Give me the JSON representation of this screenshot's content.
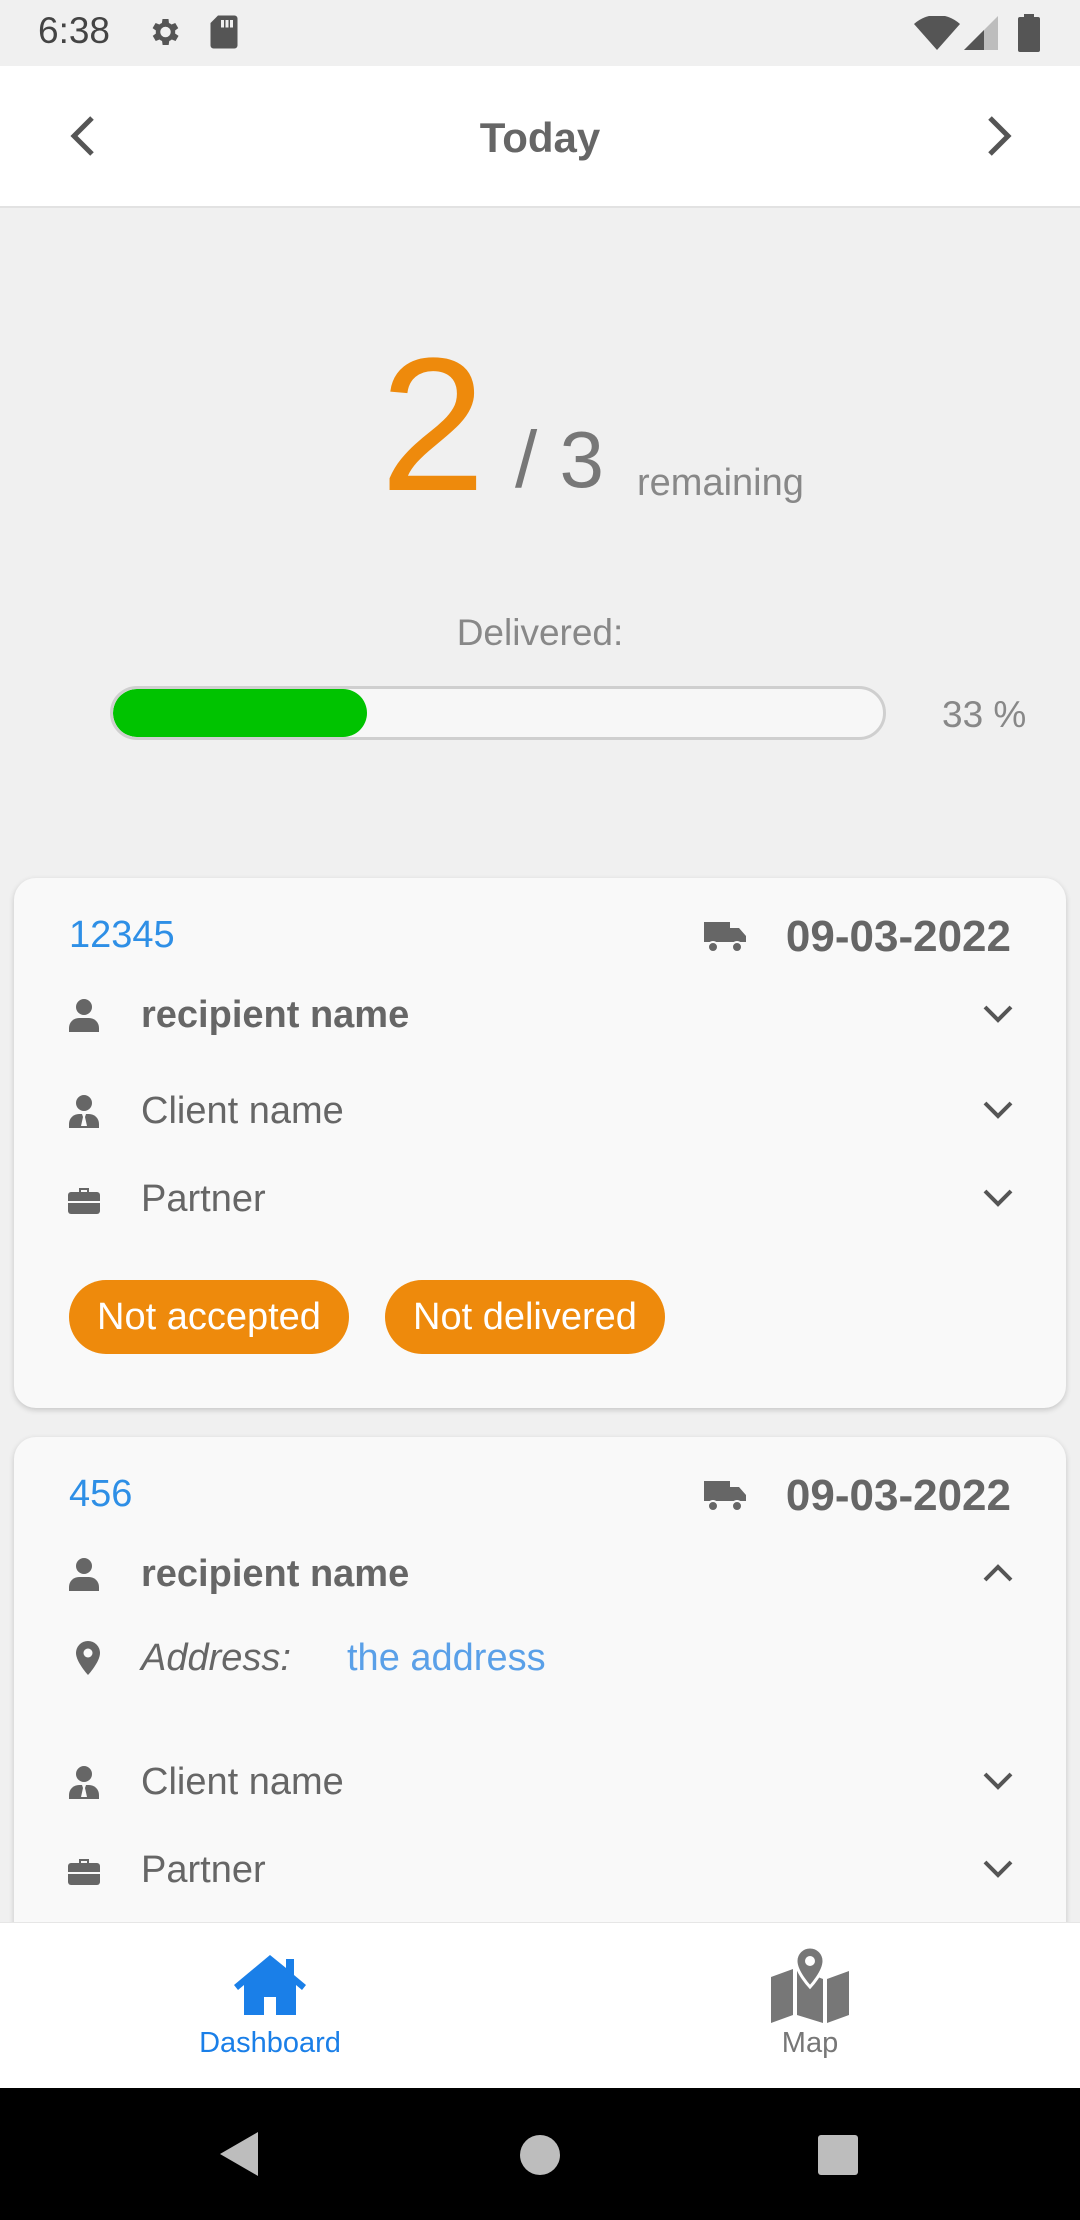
{
  "status_bar": {
    "time": "6:38"
  },
  "header": {
    "title": "Today"
  },
  "summary": {
    "remaining_count": "2",
    "total": "/ 3",
    "remaining_label": "remaining"
  },
  "progress": {
    "label": "Delivered:",
    "percent_text": "33 %",
    "fraction": 0.33
  },
  "cards": [
    {
      "id": "12345",
      "date": "09-03-2022",
      "recipient": "recipient name",
      "client": "Client name",
      "partner": "Partner",
      "badges": [
        "Not accepted",
        "Not delivered"
      ]
    },
    {
      "id": "456",
      "date": "09-03-2022",
      "recipient": "recipient name",
      "address_label": "Address:",
      "address_value": "the address",
      "client": "Client name",
      "partner": "Partner"
    }
  ],
  "bottom_nav": {
    "tabs": [
      {
        "label": "Dashboard",
        "icon": "home-icon",
        "active": true
      },
      {
        "label": "Map",
        "icon": "map-icon",
        "active": false
      }
    ]
  },
  "colors": {
    "accent": "#ee8a0c",
    "link": "#2e8fe6",
    "progress": "#00c300",
    "active_tab": "#1a7fe8",
    "inactive_tab": "#777777"
  }
}
